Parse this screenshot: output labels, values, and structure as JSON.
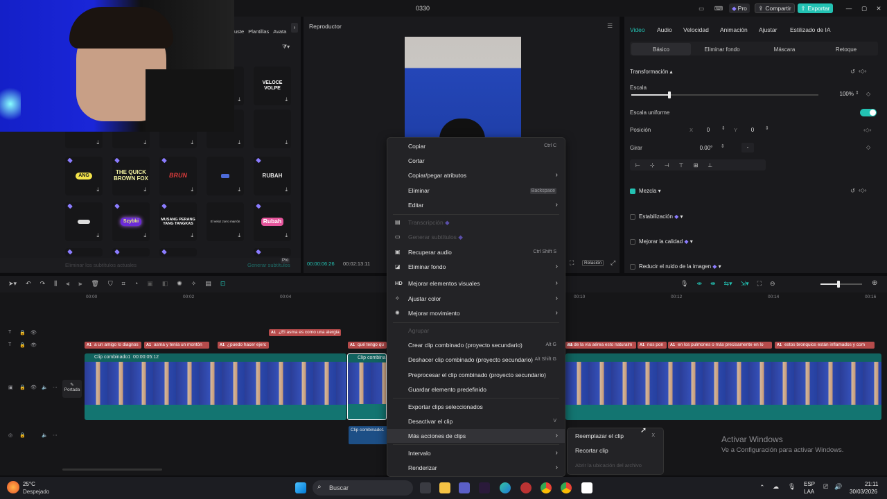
{
  "titlebar": {
    "title": "0330",
    "pro": "Pro",
    "share": "Compartir",
    "export": "Exportar"
  },
  "media": {
    "tabs": [
      "uste",
      "Plantillas",
      "Avata"
    ],
    "filter_icon": "filter-icon",
    "tiles": [
      {
        "label": "VELOCE VOLPE"
      },
      {
        "label": "ANG"
      },
      {
        "label": "THE QUICK BROWN FOX"
      },
      {
        "label": "BRUN"
      },
      {
        "label": "RUBAH"
      },
      {
        "label": "Szybki"
      },
      {
        "label": "MUSANG PERANG YANG TANGKAS"
      },
      {
        "label": "El veloz zorro marrón"
      },
      {
        "label": "Rubah"
      }
    ],
    "footer_left": "Eliminar los subtítulos actuales",
    "footer_right": "Generar subtítulos",
    "footer_pro": "Pro"
  },
  "player": {
    "title": "Reproductor",
    "time_current": "00:00:06:26",
    "time_total": "00:02:13:11",
    "ratio": "Relación"
  },
  "inspector": {
    "tabs": [
      "Video",
      "Audio",
      "Velocidad",
      "Animación",
      "Ajustar",
      "Estilizado de IA"
    ],
    "subtabs": [
      "Básico",
      "Eliminar fondo",
      "Máscara",
      "Retoque"
    ],
    "transform": "Transformación",
    "scale_label": "Escala",
    "scale_value": "100%",
    "uniform_scale": "Escala uniforme",
    "position_label": "Posición",
    "pos_x_label": "X",
    "pos_x": "0",
    "pos_y_label": "Y",
    "pos_y": "0",
    "rotate_label": "Girar",
    "rotate_value": "0.00°",
    "rotate_dash": "-",
    "mix": "Mezcla",
    "stabilization": "Estabilización",
    "quality": "Mejorar la calidad",
    "noise": "Reducir el ruido de la imagen"
  },
  "timeline": {
    "ruler": [
      "00:00",
      "00:02",
      "00:04",
      "00:10",
      "00:12",
      "00:14",
      "00:16"
    ],
    "captions_top": [
      "¿El asma es como una alergia"
    ],
    "captions": [
      "a un amigo lo diagnos",
      "asma y tenía un montón",
      "¿puedo hacer ejerc",
      "qué tengo qu",
      "ica de la vía aérea esto naturalm",
      "nos pon",
      "en los pulmones o más precisamente en lo",
      "estos bronquios están inflamados y com"
    ],
    "clip1_label": "Clip combinado1",
    "clip1_time": "00:00:05:12",
    "clip2_label": "Clip combina",
    "audio_clip_label": "Clip combinado1",
    "cover_label": "Portada"
  },
  "context_menu": {
    "items": [
      {
        "label": "Copiar",
        "shortcut": "Ctrl C"
      },
      {
        "label": "Cortar"
      },
      {
        "label": "Copiar/pegar atributos",
        "submenu": true
      },
      {
        "label": "Eliminar",
        "shortcut": "Backspace"
      },
      {
        "label": "Editar",
        "submenu": true
      },
      {
        "label": "Transcripción",
        "disabled": true
      },
      {
        "label": "Generar subtítulos",
        "disabled": true
      },
      {
        "label": "Recuperar audio",
        "shortcut": "Ctrl Shift S"
      },
      {
        "label": "Eliminar fondo",
        "submenu": true
      },
      {
        "label": "Mejorar elementos visuales",
        "submenu": true,
        "icon": "HD"
      },
      {
        "label": "Ajustar color",
        "submenu": true
      },
      {
        "label": "Mejorar movimiento",
        "submenu": true
      },
      {
        "label": "Agrupar",
        "disabled": true
      },
      {
        "label": "Crear clip combinado (proyecto secundario)",
        "shortcut": "Alt G"
      },
      {
        "label": "Deshacer clip combinado (proyecto secundario)",
        "shortcut": "Alt Shift G"
      },
      {
        "label": "Preprocesar el clip combinado (proyecto secundario)"
      },
      {
        "label": "Guardar elemento predefinido"
      },
      {
        "label": "Exportar clips seleccionados"
      },
      {
        "label": "Desactivar el clip",
        "shortcut": "V"
      },
      {
        "label": "Más acciones de clips",
        "submenu": true,
        "highlighted": true
      },
      {
        "label": "Intervalo",
        "submenu": true
      },
      {
        "label": "Renderizar",
        "submenu": true
      }
    ]
  },
  "submenu": {
    "items": [
      {
        "label": "Reemplazar el clip",
        "shortcut": "X"
      },
      {
        "label": "Recortar clip"
      },
      {
        "label": "Abrir la ubicación del archivo",
        "disabled": true
      }
    ]
  },
  "watermark": {
    "line1": "Activar Windows",
    "line2": "Ve a Configuración para activar Windows."
  },
  "taskbar": {
    "temp": "25°C",
    "weather": "Despejado",
    "search": "Buscar",
    "lang1": "ESP",
    "lang2": "LAA",
    "time": "21:11",
    "date": "30/03/2026"
  },
  "colors": {
    "accent": "#23c2b3",
    "caption": "#b64b4b",
    "clip": "#11635f",
    "pro": "#8b7cff"
  }
}
